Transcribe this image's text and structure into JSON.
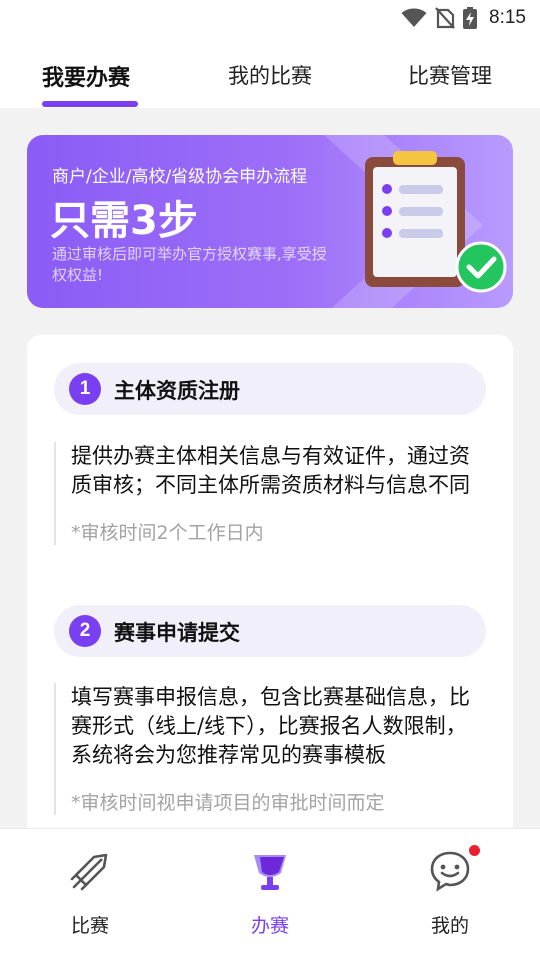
{
  "status_bar": {
    "time": "8:15",
    "icons": [
      "wifi-icon",
      "no-sim-icon",
      "battery-charging-icon"
    ]
  },
  "top_tabs": [
    {
      "label": "我要办赛",
      "active": true
    },
    {
      "label": "我的比赛",
      "active": false
    },
    {
      "label": "比赛管理",
      "active": false
    }
  ],
  "banner": {
    "subtitle": "商户/企业/高校/省级协会申办流程",
    "headline": "只需3步",
    "description": "通过审核后即可举办官方授权赛事,享受授权权益!",
    "icon": "clipboard-check-icon"
  },
  "steps": [
    {
      "number": "1",
      "title": "主体资质注册",
      "text": "提供办赛主体相关信息与有效证件，通过资质审核；不同主体所需资质材料与信息不同",
      "note": "*审核时间2个工作日内"
    },
    {
      "number": "2",
      "title": "赛事申请提交",
      "text": "填写赛事申报信息，包含比赛基础信息，比赛形式（线上/线下），比赛报名人数限制，系统将会为您推荐常见的赛事模板",
      "note": "*审核时间视申请项目的审批时间而定"
    }
  ],
  "bottom_nav": [
    {
      "label": "比赛",
      "icon": "rocket-icon",
      "active": false
    },
    {
      "label": "办赛",
      "icon": "trophy-icon",
      "active": true
    },
    {
      "label": "我的",
      "icon": "chat-face-icon",
      "active": false,
      "badge": true
    }
  ],
  "colors": {
    "accent": "#7b3ff2",
    "banner_start": "#8b5cf6",
    "banner_end": "#b89bff",
    "badge": "#e8202f",
    "check_green": "#22c55e"
  }
}
